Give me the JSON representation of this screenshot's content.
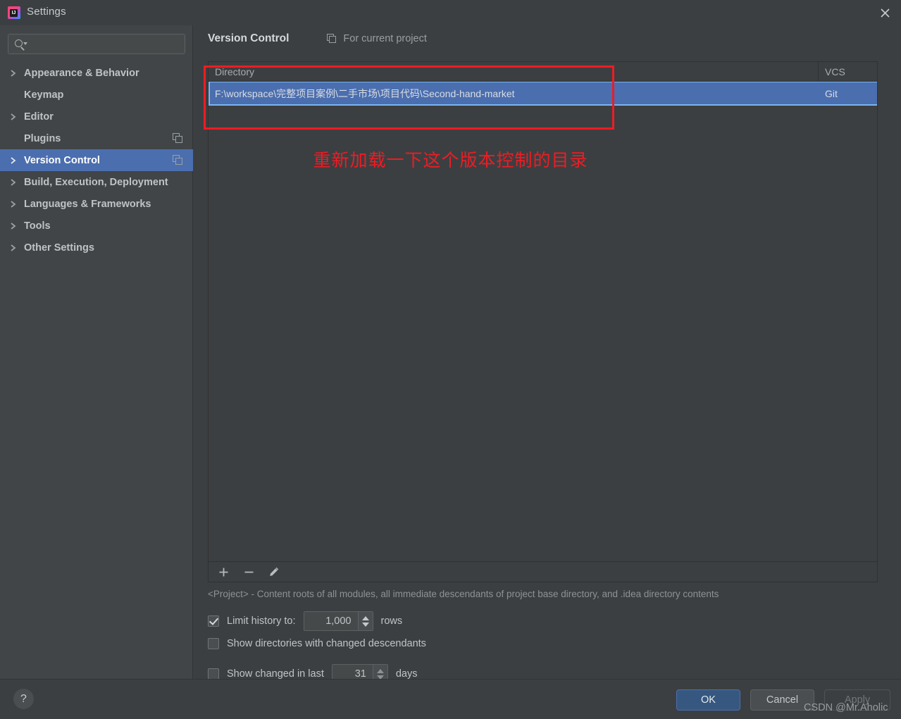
{
  "window": {
    "title": "Settings",
    "app_icon": "intellij-idea-icon",
    "close_icon": "close-icon"
  },
  "search": {
    "value": "",
    "placeholder": "",
    "icon": "search-icon"
  },
  "sidebar": {
    "items": [
      {
        "label": "Appearance & Behavior",
        "expandable": true,
        "selected": false,
        "scope_icon": false
      },
      {
        "label": "Keymap",
        "expandable": false,
        "selected": false,
        "scope_icon": false
      },
      {
        "label": "Editor",
        "expandable": true,
        "selected": false,
        "scope_icon": false
      },
      {
        "label": "Plugins",
        "expandable": false,
        "selected": false,
        "scope_icon": true
      },
      {
        "label": "Version Control",
        "expandable": true,
        "selected": true,
        "scope_icon": true
      },
      {
        "label": "Build, Execution, Deployment",
        "expandable": true,
        "selected": false,
        "scope_icon": false
      },
      {
        "label": "Languages & Frameworks",
        "expandable": true,
        "selected": false,
        "scope_icon": false
      },
      {
        "label": "Tools",
        "expandable": true,
        "selected": false,
        "scope_icon": false
      },
      {
        "label": "Other Settings",
        "expandable": true,
        "selected": false,
        "scope_icon": false
      }
    ]
  },
  "content": {
    "title": "Version Control",
    "for_current_project": "For current project",
    "for_project_icon": "project-scope-icon"
  },
  "table": {
    "columns": [
      "Directory",
      "VCS"
    ],
    "rows": [
      {
        "directory": "F:\\workspace\\完整项目案例\\二手市场\\项目代码\\Second-hand-market",
        "vcs": "Git",
        "selected": true
      }
    ]
  },
  "toolbar": {
    "add_icon": "plus-icon",
    "remove_icon": "minus-icon",
    "edit_icon": "pencil-icon"
  },
  "hint": "<Project> - Content roots of all modules, all immediate descendants of project base directory, and .idea directory contents",
  "options": {
    "limit_history": {
      "label": "Limit history to:",
      "checked": true,
      "value": "1,000",
      "unit": "rows"
    },
    "show_dirs_changed_descendants": {
      "label": "Show directories with changed descendants",
      "checked": false
    },
    "show_changed_in_last": {
      "label": "Show changed in last",
      "checked": false,
      "value": "31",
      "unit": "days"
    }
  },
  "annotation": {
    "note": "重新加载一下这个版本控制的目录",
    "color": "#ee1c24"
  },
  "footer": {
    "help_label": "?",
    "ok": "OK",
    "cancel": "Cancel",
    "apply": "Apply"
  },
  "watermark": "CSDN @Mr.Aholic"
}
